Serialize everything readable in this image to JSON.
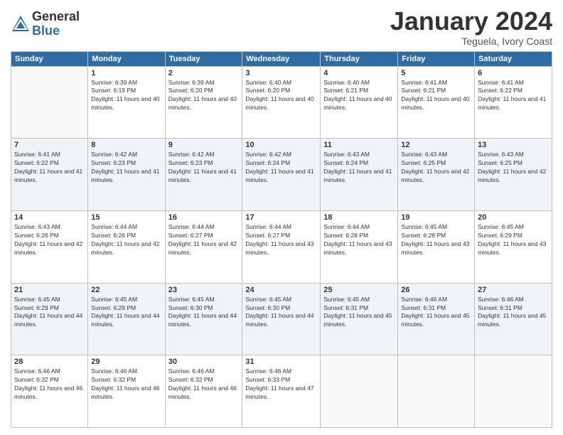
{
  "header": {
    "logo_general": "General",
    "logo_blue": "Blue",
    "month_title": "January 2024",
    "subtitle": "Teguela, Ivory Coast"
  },
  "days_of_week": [
    "Sunday",
    "Monday",
    "Tuesday",
    "Wednesday",
    "Thursday",
    "Friday",
    "Saturday"
  ],
  "weeks": [
    [
      {
        "num": "",
        "empty": true
      },
      {
        "num": "1",
        "sunrise": "Sunrise: 6:39 AM",
        "sunset": "Sunset: 6:19 PM",
        "daylight": "Daylight: 11 hours and 40 minutes."
      },
      {
        "num": "2",
        "sunrise": "Sunrise: 6:39 AM",
        "sunset": "Sunset: 6:20 PM",
        "daylight": "Daylight: 11 hours and 40 minutes."
      },
      {
        "num": "3",
        "sunrise": "Sunrise: 6:40 AM",
        "sunset": "Sunset: 6:20 PM",
        "daylight": "Daylight: 11 hours and 40 minutes."
      },
      {
        "num": "4",
        "sunrise": "Sunrise: 6:40 AM",
        "sunset": "Sunset: 6:21 PM",
        "daylight": "Daylight: 11 hours and 40 minutes."
      },
      {
        "num": "5",
        "sunrise": "Sunrise: 6:41 AM",
        "sunset": "Sunset: 6:21 PM",
        "daylight": "Daylight: 11 hours and 40 minutes."
      },
      {
        "num": "6",
        "sunrise": "Sunrise: 6:41 AM",
        "sunset": "Sunset: 6:22 PM",
        "daylight": "Daylight: 11 hours and 41 minutes."
      }
    ],
    [
      {
        "num": "7",
        "sunrise": "Sunrise: 6:41 AM",
        "sunset": "Sunset: 6:22 PM",
        "daylight": "Daylight: 11 hours and 41 minutes."
      },
      {
        "num": "8",
        "sunrise": "Sunrise: 6:42 AM",
        "sunset": "Sunset: 6:23 PM",
        "daylight": "Daylight: 11 hours and 41 minutes."
      },
      {
        "num": "9",
        "sunrise": "Sunrise: 6:42 AM",
        "sunset": "Sunset: 6:23 PM",
        "daylight": "Daylight: 11 hours and 41 minutes."
      },
      {
        "num": "10",
        "sunrise": "Sunrise: 6:42 AM",
        "sunset": "Sunset: 6:24 PM",
        "daylight": "Daylight: 11 hours and 41 minutes."
      },
      {
        "num": "11",
        "sunrise": "Sunrise: 6:43 AM",
        "sunset": "Sunset: 6:24 PM",
        "daylight": "Daylight: 11 hours and 41 minutes."
      },
      {
        "num": "12",
        "sunrise": "Sunrise: 6:43 AM",
        "sunset": "Sunset: 6:25 PM",
        "daylight": "Daylight: 11 hours and 42 minutes."
      },
      {
        "num": "13",
        "sunrise": "Sunrise: 6:43 AM",
        "sunset": "Sunset: 6:25 PM",
        "daylight": "Daylight: 11 hours and 42 minutes."
      }
    ],
    [
      {
        "num": "14",
        "sunrise": "Sunrise: 6:43 AM",
        "sunset": "Sunset: 6:26 PM",
        "daylight": "Daylight: 11 hours and 42 minutes."
      },
      {
        "num": "15",
        "sunrise": "Sunrise: 6:44 AM",
        "sunset": "Sunset: 6:26 PM",
        "daylight": "Daylight: 11 hours and 42 minutes."
      },
      {
        "num": "16",
        "sunrise": "Sunrise: 6:44 AM",
        "sunset": "Sunset: 6:27 PM",
        "daylight": "Daylight: 11 hours and 42 minutes."
      },
      {
        "num": "17",
        "sunrise": "Sunrise: 6:44 AM",
        "sunset": "Sunset: 6:27 PM",
        "daylight": "Daylight: 11 hours and 43 minutes."
      },
      {
        "num": "18",
        "sunrise": "Sunrise: 6:44 AM",
        "sunset": "Sunset: 6:28 PM",
        "daylight": "Daylight: 11 hours and 43 minutes."
      },
      {
        "num": "19",
        "sunrise": "Sunrise: 6:45 AM",
        "sunset": "Sunset: 6:28 PM",
        "daylight": "Daylight: 11 hours and 43 minutes."
      },
      {
        "num": "20",
        "sunrise": "Sunrise: 6:45 AM",
        "sunset": "Sunset: 6:29 PM",
        "daylight": "Daylight: 11 hours and 43 minutes."
      }
    ],
    [
      {
        "num": "21",
        "sunrise": "Sunrise: 6:45 AM",
        "sunset": "Sunset: 6:29 PM",
        "daylight": "Daylight: 11 hours and 44 minutes."
      },
      {
        "num": "22",
        "sunrise": "Sunrise: 6:45 AM",
        "sunset": "Sunset: 6:29 PM",
        "daylight": "Daylight: 11 hours and 44 minutes."
      },
      {
        "num": "23",
        "sunrise": "Sunrise: 6:45 AM",
        "sunset": "Sunset: 6:30 PM",
        "daylight": "Daylight: 11 hours and 44 minutes."
      },
      {
        "num": "24",
        "sunrise": "Sunrise: 6:45 AM",
        "sunset": "Sunset: 6:30 PM",
        "daylight": "Daylight: 11 hours and 44 minutes."
      },
      {
        "num": "25",
        "sunrise": "Sunrise: 6:45 AM",
        "sunset": "Sunset: 6:31 PM",
        "daylight": "Daylight: 11 hours and 45 minutes."
      },
      {
        "num": "26",
        "sunrise": "Sunrise: 6:46 AM",
        "sunset": "Sunset: 6:31 PM",
        "daylight": "Daylight: 11 hours and 45 minutes."
      },
      {
        "num": "27",
        "sunrise": "Sunrise: 6:46 AM",
        "sunset": "Sunset: 6:31 PM",
        "daylight": "Daylight: 11 hours and 45 minutes."
      }
    ],
    [
      {
        "num": "28",
        "sunrise": "Sunrise: 6:46 AM",
        "sunset": "Sunset: 6:32 PM",
        "daylight": "Daylight: 11 hours and 46 minutes."
      },
      {
        "num": "29",
        "sunrise": "Sunrise: 6:46 AM",
        "sunset": "Sunset: 6:32 PM",
        "daylight": "Daylight: 11 hours and 46 minutes."
      },
      {
        "num": "30",
        "sunrise": "Sunrise: 6:46 AM",
        "sunset": "Sunset: 6:32 PM",
        "daylight": "Daylight: 11 hours and 46 minutes."
      },
      {
        "num": "31",
        "sunrise": "Sunrise: 6:46 AM",
        "sunset": "Sunset: 6:33 PM",
        "daylight": "Daylight: 11 hours and 47 minutes."
      },
      {
        "num": "",
        "empty": true
      },
      {
        "num": "",
        "empty": true
      },
      {
        "num": "",
        "empty": true
      }
    ]
  ]
}
